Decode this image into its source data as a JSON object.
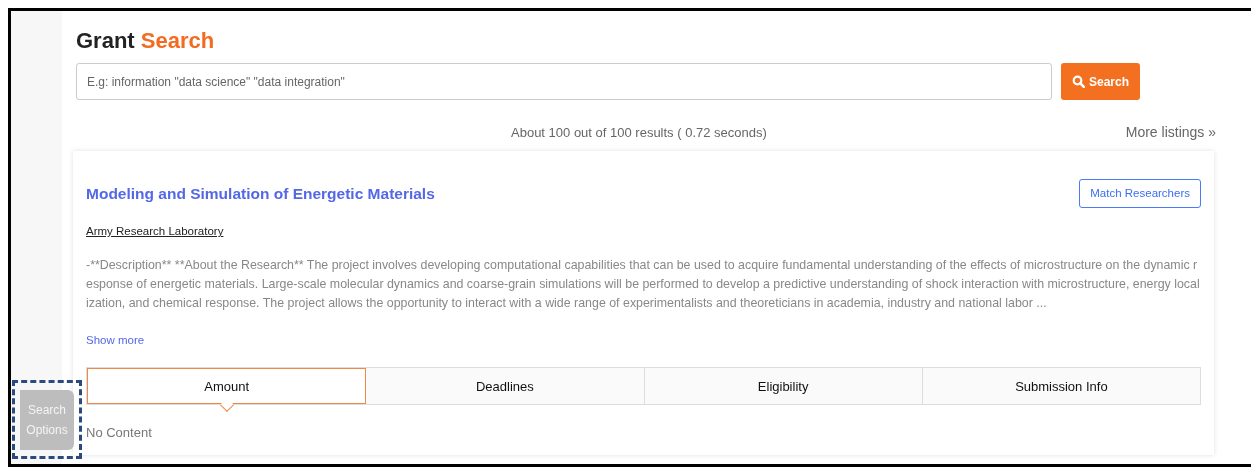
{
  "title": {
    "text": "Grant",
    "highlight": "Search"
  },
  "search": {
    "placeholder": "E.g: information \"data science\" \"data integration\"",
    "button": "Search"
  },
  "results_summary": "About 100 out of 100 results ( 0.72 seconds)",
  "more_link": "More listings »",
  "grant": {
    "title": "Modeling and Simulation of Energetic Materials",
    "action": "Match Researchers",
    "agency": "Army Research Laboratory",
    "description": "-**Description** **About the Research** The project involves developing computational capabilities that can be used to acquire fundamental understanding of the effects of microstructure on the dynamic response of energetic materials. Large-scale molecular dynamics and coarse-grain simulations will be performed to develop a predictive understanding of shock interaction with microstructure, energy localization, and chemical response. The project allows the opportunity to interact with a wide range of experimentalists and theoreticians in academia, industry and national labor ...",
    "show_more": "Show more",
    "tabs": [
      {
        "label": "Amount",
        "selected": true
      },
      {
        "label": "Deadlines",
        "selected": false
      },
      {
        "label": "Eligibility",
        "selected": false
      },
      {
        "label": "Submission Info",
        "selected": false
      }
    ],
    "tab_content": "No Content"
  },
  "side_button": {
    "label": "Search Options",
    "highlighted": true
  }
}
